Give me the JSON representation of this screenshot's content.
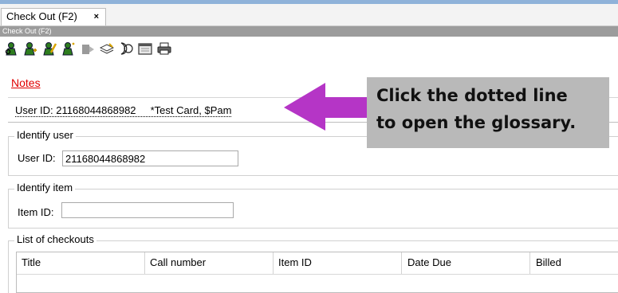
{
  "tab": {
    "label": "Check Out (F2)",
    "close_glyph": "×"
  },
  "mode_bar": {
    "label": "Check Out (F2)"
  },
  "toolbar": {
    "icons": [
      "find-user-icon",
      "add-user-icon",
      "edit-user-icon",
      "user-info-icon",
      "print-slip-icon",
      "notes-icon",
      "glossary-icon",
      "calendar-icon",
      "printer-icon"
    ]
  },
  "notes_link": "Notes",
  "user_summary": "User ID: 21168044868982     *Test Card, $Pam",
  "identify_user": {
    "legend": "Identify user",
    "label": "User ID:",
    "value": "21168044868982"
  },
  "identify_item": {
    "legend": "Identify item",
    "label": "Item ID:",
    "value": ""
  },
  "checkouts": {
    "legend": "List of checkouts",
    "columns": [
      "Title",
      "Call number",
      "Item ID",
      "Date Due",
      "Billed"
    ]
  },
  "callout": {
    "line1": "Click the dotted line",
    "line2": "to open the glossary."
  },
  "colors": {
    "arrow": "#b535c6",
    "notes": "#e00000",
    "callout_bg": "#b9b9b9"
  }
}
